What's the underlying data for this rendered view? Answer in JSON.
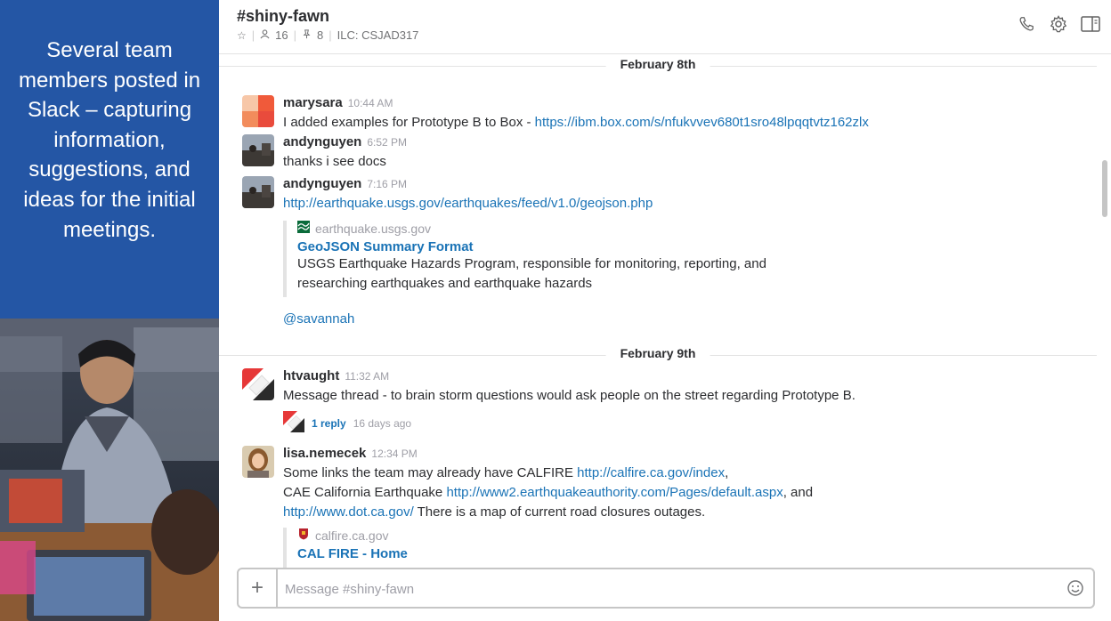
{
  "caption": "Several team members posted in Slack – capturing information, suggestions, and ideas for the initial meetings.",
  "header": {
    "channel": "#shiny-fawn",
    "members_count": "16",
    "pinned_count": "8",
    "ilc": "ILC: CSJAD317"
  },
  "days": [
    {
      "label": "February 8th"
    },
    {
      "label": "February 9th"
    }
  ],
  "messages": [
    {
      "user": "marysara",
      "time": "10:44 AM",
      "text": "I added examples for Prototype B to Box  - ",
      "link": "https://ibm.box.com/s/nfukvvev680t1sro48lpqqtvtz162zlx"
    },
    {
      "user": "andynguyen",
      "time": "6:52 PM",
      "text": "thanks i see docs"
    },
    {
      "user": "andynguyen",
      "time": "7:16 PM",
      "link": "http://earthquake.usgs.gov/earthquakes/feed/v1.0/geojson.php",
      "attachment": {
        "service": "earthquake.usgs.gov",
        "title": "GeoJSON Summary Format",
        "desc1": "USGS Earthquake Hazards Program, responsible for monitoring, reporting, and",
        "desc2": "researching earthquakes and earthquake hazards"
      },
      "mention": "@savannah"
    },
    {
      "user": "htvaught",
      "time": "11:32 AM",
      "text": "Message thread - to brain storm questions would ask people on the street regarding Prototype B.",
      "reply_label": "1 reply",
      "reply_ago": "16 days ago"
    },
    {
      "user": "lisa.nemecek",
      "time": "12:34 PM",
      "line1_text": "Some links the team may already have  CALFIRE ",
      "line1_link": "http://calfire.ca.gov/index",
      "line1_after": ",",
      "line2_text": "CAE California Earthquake ",
      "line2_link": "http://www2.earthquakeauthority.com/Pages/default.aspx",
      "line2_after": ", and",
      "line3_link": "http://www.dot.ca.gov/",
      "line3_after": "  There is a map of current road closures outages.",
      "attachment": {
        "service": "calfire.ca.gov",
        "title": "CAL FIRE - Home"
      }
    }
  ],
  "composer": {
    "placeholder": "Message #shiny-fawn"
  },
  "colors": {
    "caption_bg": "#2456a5",
    "link": "#1a73b6"
  }
}
